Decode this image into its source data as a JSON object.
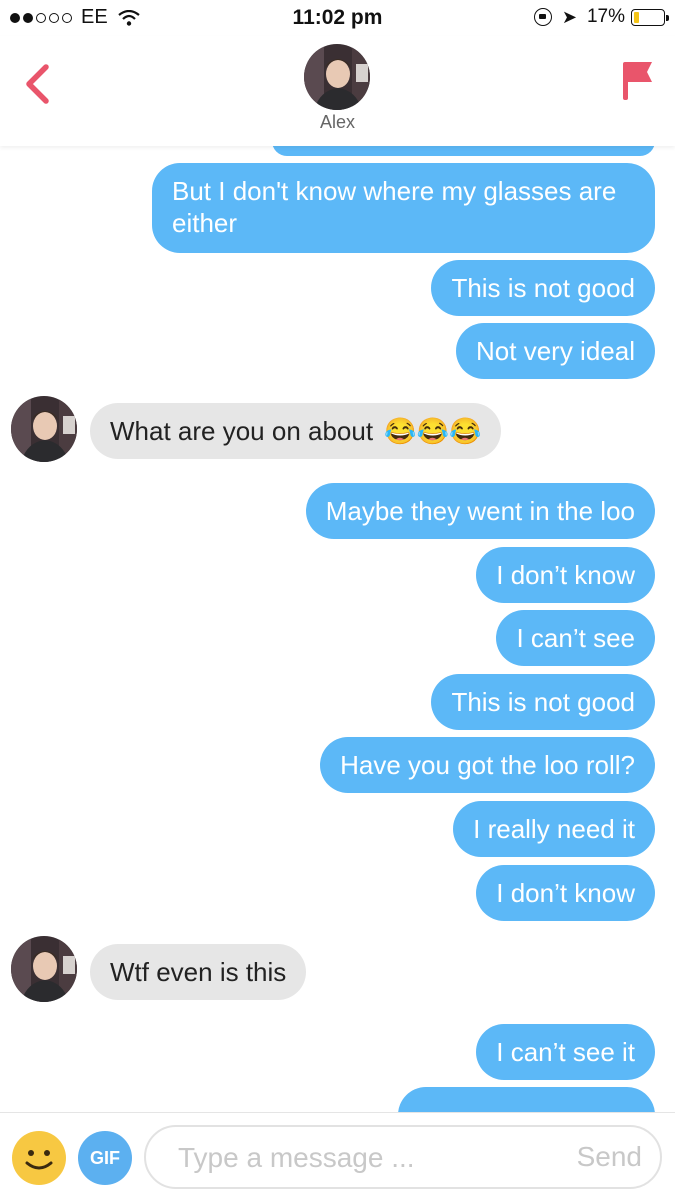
{
  "status_bar": {
    "carrier": "EE",
    "time": "11:02 pm",
    "battery": "17%",
    "battery_level": 0.17,
    "signal_bars_filled": 2,
    "signal_bars_total": 5
  },
  "header": {
    "contact_name": "Alex",
    "back_icon": "chevron-left-icon",
    "report_icon": "flag-icon",
    "accent_color": "#e9556b"
  },
  "messages": [
    {
      "sender": "me",
      "text": "But I don't know where my glasses are"
    },
    {
      "sender": "me",
      "text": "either"
    },
    {
      "sender": "me",
      "text": "This is not good"
    },
    {
      "sender": "me",
      "text": "Not very ideal"
    },
    {
      "sender": "them",
      "text": "What are you on about",
      "emoji": "😂😂😂"
    },
    {
      "sender": "me",
      "text": "Maybe they went in the loo"
    },
    {
      "sender": "me",
      "text": "I don’t know"
    },
    {
      "sender": "me",
      "text": "I can’t see"
    },
    {
      "sender": "me",
      "text": "This is not good"
    },
    {
      "sender": "me",
      "text": "Have you got the loo roll?"
    },
    {
      "sender": "me",
      "text": "I really need it"
    },
    {
      "sender": "me",
      "text": "I don’t know"
    },
    {
      "sender": "them",
      "text": "Wtf even is this"
    },
    {
      "sender": "me",
      "text": "I can’t see it"
    }
  ],
  "input_bar": {
    "emoji_icon": "smiley-icon",
    "gif_label": "GIF",
    "placeholder": "Type a message ...",
    "send_label": "Send"
  },
  "colors": {
    "outgoing_bubble": "#5cb8f7",
    "incoming_bubble": "#e6e6e6"
  }
}
